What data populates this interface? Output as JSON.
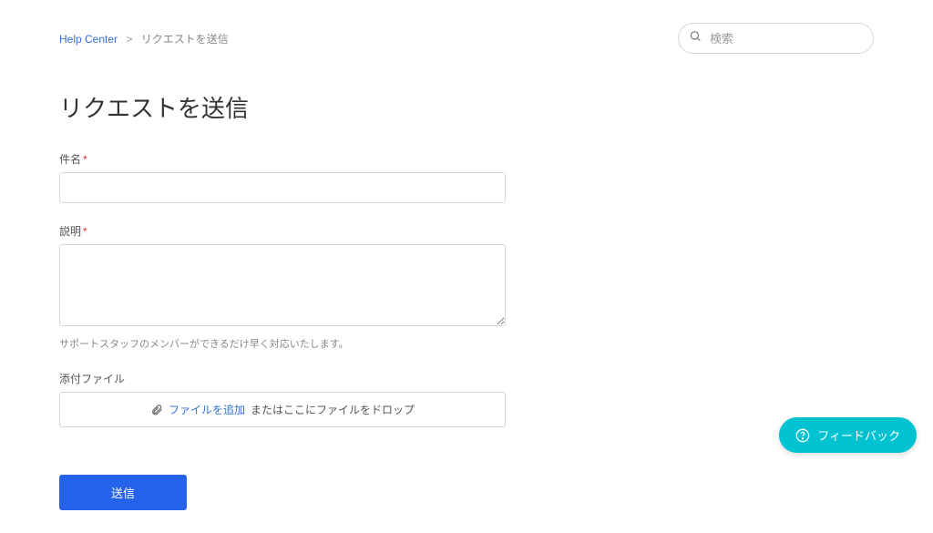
{
  "breadcrumb": {
    "home_label": "Help Center",
    "separator": ">",
    "current_label": "リクエストを送信"
  },
  "search": {
    "placeholder": "検索"
  },
  "page": {
    "title": "リクエストを送信"
  },
  "form": {
    "subject": {
      "label": "件名",
      "required_mark": "*",
      "value": ""
    },
    "description": {
      "label": "説明",
      "required_mark": "*",
      "value": "",
      "hint": "サポートスタッフのメンバーができるだけ早く対応いたします。"
    },
    "attachment": {
      "label": "添付ファイル",
      "link_text": "ファイルを追加",
      "suffix_text": "またはここにファイルをドロップ"
    },
    "submit_label": "送信"
  },
  "feedback": {
    "label": "フィードバック"
  }
}
